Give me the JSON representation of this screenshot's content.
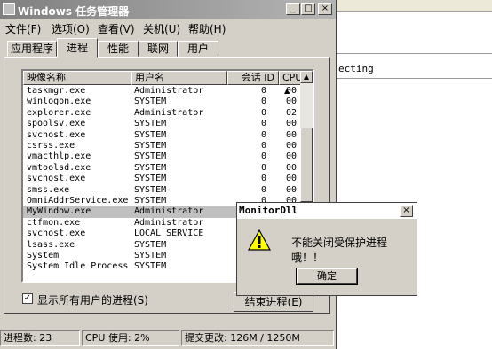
{
  "background_app": {
    "text": "ecting"
  },
  "window": {
    "title": "Windows 任务管理器",
    "min_glyph": "_",
    "max_glyph": "□",
    "close_glyph": "×"
  },
  "menu": [
    "文件(F)",
    "选项(O)",
    "查看(V)",
    "关机(U)",
    "帮助(H)"
  ],
  "tabs": [
    "应用程序",
    "进程",
    "性能",
    "联网",
    "用户"
  ],
  "active_tab": "进程",
  "columns": [
    "映像名称",
    "用户名",
    "会话 ID",
    "CPU"
  ],
  "sort_indicator": "▲",
  "processes": [
    {
      "name": "taskmgr.exe",
      "user": "Administrator",
      "session": "0",
      "cpu": "00"
    },
    {
      "name": "winlogon.exe",
      "user": "SYSTEM",
      "session": "0",
      "cpu": "00"
    },
    {
      "name": "explorer.exe",
      "user": "Administrator",
      "session": "0",
      "cpu": "02"
    },
    {
      "name": "spoolsv.exe",
      "user": "SYSTEM",
      "session": "0",
      "cpu": "00"
    },
    {
      "name": "svchost.exe",
      "user": "SYSTEM",
      "session": "0",
      "cpu": "00"
    },
    {
      "name": "csrss.exe",
      "user": "SYSTEM",
      "session": "0",
      "cpu": "00"
    },
    {
      "name": "vmacthlp.exe",
      "user": "SYSTEM",
      "session": "0",
      "cpu": "00"
    },
    {
      "name": "vmtoolsd.exe",
      "user": "SYSTEM",
      "session": "0",
      "cpu": "00"
    },
    {
      "name": "svchost.exe",
      "user": "SYSTEM",
      "session": "0",
      "cpu": "00"
    },
    {
      "name": "smss.exe",
      "user": "SYSTEM",
      "session": "0",
      "cpu": "00"
    },
    {
      "name": "OmniAddrService.exe",
      "user": "SYSTEM",
      "session": "0",
      "cpu": "00"
    },
    {
      "name": "MyWindow.exe",
      "user": "Administrator",
      "session": "",
      "cpu": ""
    },
    {
      "name": "ctfmon.exe",
      "user": "Administrator",
      "session": "",
      "cpu": ""
    },
    {
      "name": "svchost.exe",
      "user": "LOCAL SERVICE",
      "session": "",
      "cpu": ""
    },
    {
      "name": "lsass.exe",
      "user": "SYSTEM",
      "session": "",
      "cpu": ""
    },
    {
      "name": "System",
      "user": "SYSTEM",
      "session": "",
      "cpu": ""
    },
    {
      "name": "System Idle Process",
      "user": "SYSTEM",
      "session": "",
      "cpu": ""
    }
  ],
  "selected_process": "MyWindow.exe",
  "show_all_users": {
    "checked": true,
    "label": "显示所有用户的进程(S)",
    "check_glyph": "✓"
  },
  "end_process_label": "结束进程(E)",
  "status": {
    "processes": "进程数: 23",
    "cpu": "CPU 使用: 2%",
    "commit": "提交更改: 126M / 1250M"
  },
  "dialog": {
    "title": "MonitorDll",
    "close_glyph": "×",
    "icon": "warning-icon",
    "message": "不能关闭受保护进程哦！！",
    "ok_label": "确定"
  }
}
